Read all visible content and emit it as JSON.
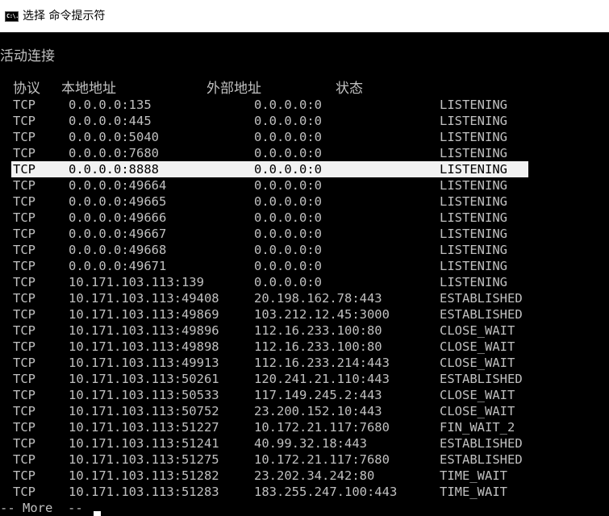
{
  "window": {
    "icon_glyph": "C:\\.",
    "title": "选择 命令提示符"
  },
  "console": {
    "heading": "活动连接",
    "columns": {
      "proto": "协议",
      "local": "本地地址",
      "foreign": "外部地址",
      "state": "状态"
    },
    "rows": [
      {
        "proto": "TCP",
        "local": "0.0.0.0:135",
        "foreign": "0.0.0.0:0",
        "state": "LISTENING"
      },
      {
        "proto": "TCP",
        "local": "0.0.0.0:445",
        "foreign": "0.0.0.0:0",
        "state": "LISTENING"
      },
      {
        "proto": "TCP",
        "local": "0.0.0.0:5040",
        "foreign": "0.0.0.0:0",
        "state": "LISTENING"
      },
      {
        "proto": "TCP",
        "local": "0.0.0.0:7680",
        "foreign": "0.0.0.0:0",
        "state": "LISTENING"
      },
      {
        "proto": "TCP",
        "local": "0.0.0.0:8888",
        "foreign": "0.0.0.0:0",
        "state": "LISTENING",
        "selected": true
      },
      {
        "proto": "TCP",
        "local": "0.0.0.0:49664",
        "foreign": "0.0.0.0:0",
        "state": "LISTENING"
      },
      {
        "proto": "TCP",
        "local": "0.0.0.0:49665",
        "foreign": "0.0.0.0:0",
        "state": "LISTENING"
      },
      {
        "proto": "TCP",
        "local": "0.0.0.0:49666",
        "foreign": "0.0.0.0:0",
        "state": "LISTENING"
      },
      {
        "proto": "TCP",
        "local": "0.0.0.0:49667",
        "foreign": "0.0.0.0:0",
        "state": "LISTENING"
      },
      {
        "proto": "TCP",
        "local": "0.0.0.0:49668",
        "foreign": "0.0.0.0:0",
        "state": "LISTENING"
      },
      {
        "proto": "TCP",
        "local": "0.0.0.0:49671",
        "foreign": "0.0.0.0:0",
        "state": "LISTENING"
      },
      {
        "proto": "TCP",
        "local": "10.171.103.113:139",
        "foreign": "0.0.0.0:0",
        "state": "LISTENING"
      },
      {
        "proto": "TCP",
        "local": "10.171.103.113:49408",
        "foreign": "20.198.162.78:443",
        "state": "ESTABLISHED"
      },
      {
        "proto": "TCP",
        "local": "10.171.103.113:49869",
        "foreign": "103.212.12.45:3000",
        "state": "ESTABLISHED"
      },
      {
        "proto": "TCP",
        "local": "10.171.103.113:49896",
        "foreign": "112.16.233.100:80",
        "state": "CLOSE_WAIT"
      },
      {
        "proto": "TCP",
        "local": "10.171.103.113:49898",
        "foreign": "112.16.233.100:80",
        "state": "CLOSE_WAIT"
      },
      {
        "proto": "TCP",
        "local": "10.171.103.113:49913",
        "foreign": "112.16.233.214:443",
        "state": "CLOSE_WAIT"
      },
      {
        "proto": "TCP",
        "local": "10.171.103.113:50261",
        "foreign": "120.241.21.110:443",
        "state": "ESTABLISHED"
      },
      {
        "proto": "TCP",
        "local": "10.171.103.113:50533",
        "foreign": "117.149.245.2:443",
        "state": "CLOSE_WAIT"
      },
      {
        "proto": "TCP",
        "local": "10.171.103.113:50752",
        "foreign": "23.200.152.10:443",
        "state": "CLOSE_WAIT"
      },
      {
        "proto": "TCP",
        "local": "10.171.103.113:51227",
        "foreign": "10.172.21.117:7680",
        "state": "FIN_WAIT_2"
      },
      {
        "proto": "TCP",
        "local": "10.171.103.113:51241",
        "foreign": "40.99.32.18:443",
        "state": "ESTABLISHED"
      },
      {
        "proto": "TCP",
        "local": "10.171.103.113:51275",
        "foreign": "10.172.21.117:7680",
        "state": "ESTABLISHED"
      },
      {
        "proto": "TCP",
        "local": "10.171.103.113:51282",
        "foreign": "23.202.34.242:80",
        "state": "TIME_WAIT"
      },
      {
        "proto": "TCP",
        "local": "10.171.103.113:51283",
        "foreign": "183.255.247.100:443",
        "state": "TIME_WAIT"
      }
    ],
    "more_prompt": "-- More  --"
  },
  "colors": {
    "console_bg": "#000000",
    "console_text": "#c0c0c0",
    "selection_bg": "#f2f2f2",
    "titlebar_bg": "#ffffff"
  }
}
